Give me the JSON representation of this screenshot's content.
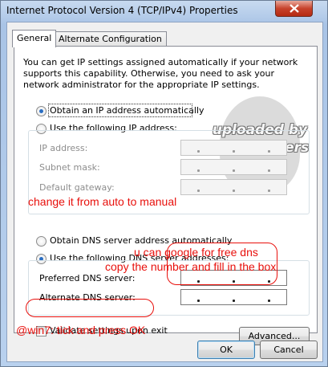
{
  "window": {
    "title": "Internet Protocol Version 4 (TCP/IPv4) Properties"
  },
  "tabs": [
    {
      "label": "General",
      "active": true
    },
    {
      "label": "Alternate Configuration",
      "active": false
    }
  ],
  "general": {
    "description": "You can get IP settings assigned automatically if your network supports this capability. Otherwise, you need to ask your network administrator for the appropriate IP settings.",
    "ip_auto_label": "Obtain an IP address automatically",
    "ip_manual_label": "Use the following IP address:",
    "ip_selected": "auto",
    "ip_address_label": "IP address:",
    "subnet_mask_label": "Subnet mask:",
    "default_gateway_label": "Default gateway:",
    "dns_auto_label": "Obtain DNS server address automatically",
    "dns_manual_label": "Use the following DNS server addresses:",
    "dns_selected": "manual",
    "preferred_dns_label": "Preferred DNS server:",
    "alternate_dns_label": "Alternate DNS server:",
    "validate_label": "Validate settings upon exit",
    "validate_checked": false,
    "advanced_label": "Advanced..."
  },
  "footer": {
    "ok_label": "OK",
    "cancel_label": "Cancel"
  },
  "annotations": {
    "change_note": "change it from auto to manual",
    "dns_note_1": "u can google for free dns",
    "dns_note_2": "copy the number and fill in the box",
    "win7_note": "@win7: tick and press OK"
  },
  "watermark": {
    "line1": "uploaded by",
    "line2": "seeksfingers"
  },
  "colors": {
    "annotation": "#e8100c",
    "accent": "#2a6ec2",
    "close": "#c7432c"
  }
}
